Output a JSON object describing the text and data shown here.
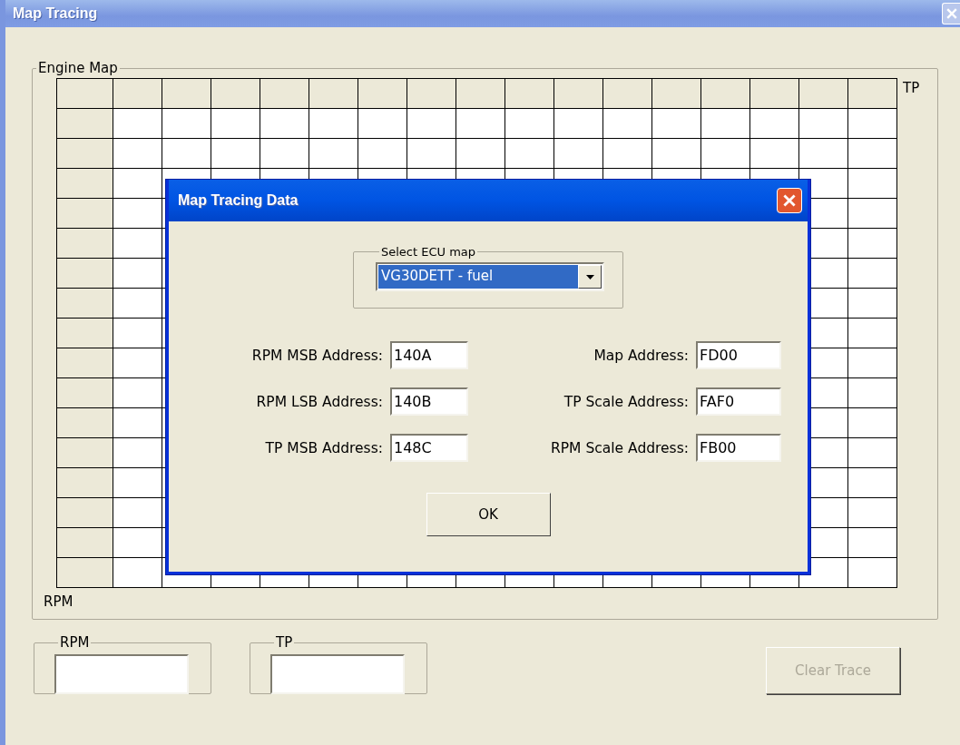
{
  "window": {
    "title": "Map Tracing"
  },
  "engine_map": {
    "label": "Engine Map",
    "x_axis_label": "TP",
    "y_axis_label": "RPM"
  },
  "readouts": [
    {
      "label": "RPM"
    },
    {
      "label": "TP"
    }
  ],
  "clear_button": {
    "label": "Clear Trace",
    "disabled": true
  },
  "dialog": {
    "title": "Map Tracing Data",
    "ecu_select": {
      "label": "Select ECU map",
      "value": "VG30DETT - fuel",
      "highlighted": true
    },
    "left_fields": [
      {
        "label": "RPM MSB Address:",
        "value": "140A"
      },
      {
        "label": "RPM LSB Address:",
        "value": "140B"
      },
      {
        "label": "TP MSB Address:",
        "value": "148C"
      }
    ],
    "right_fields": [
      {
        "label": "Map Address:",
        "value": "FD00"
      },
      {
        "label": "TP Scale Address:",
        "value": "FAF0"
      },
      {
        "label": "RPM Scale Address:",
        "value": "FB00"
      }
    ],
    "ok_button": {
      "label": "OK"
    }
  }
}
